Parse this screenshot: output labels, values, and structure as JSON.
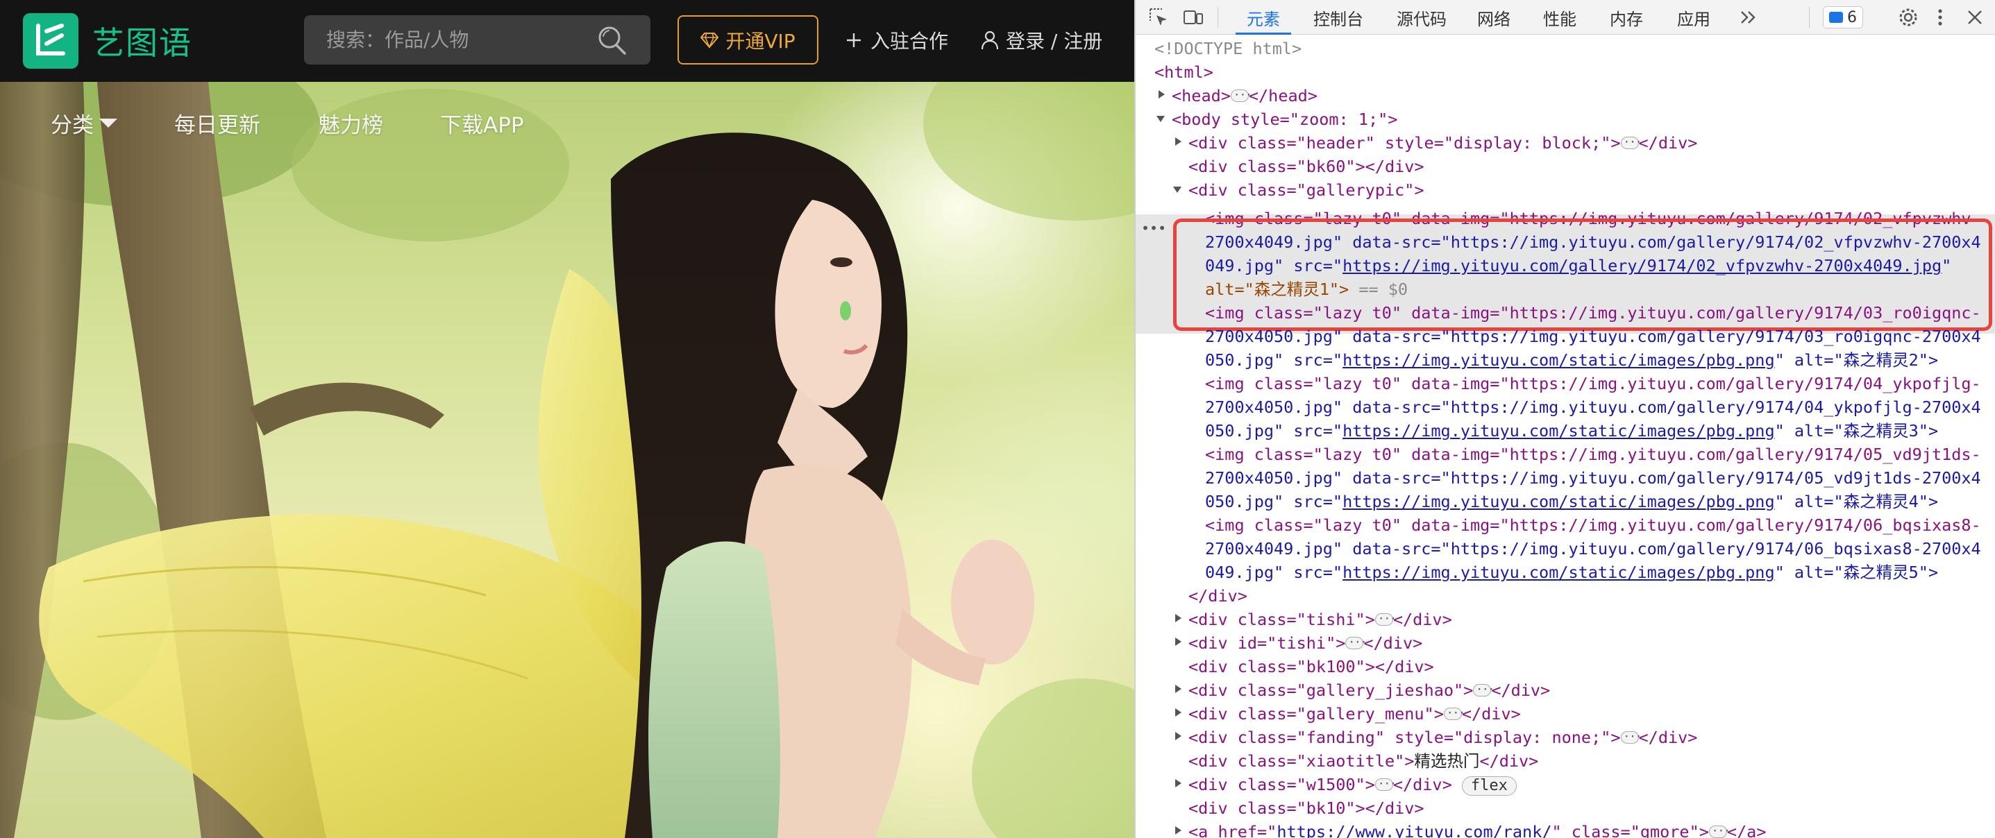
{
  "site": {
    "logo_text": "艺图语",
    "search": {
      "placeholder": "搜索：作品/人物",
      "value": ""
    },
    "vip_label": "开通VIP",
    "join_label": "入驻合作",
    "login_label": "登录 / 注册",
    "subnav": [
      "分类",
      "每日更新",
      "魅力榜",
      "下载APP"
    ],
    "colors": {
      "brand": "#14b383",
      "vip": "#e49f2d",
      "topbar": "#141414"
    },
    "hero_image_alt": "森之精灵1"
  },
  "devtools": {
    "tabs": [
      "元素",
      "控制台",
      "源代码",
      "网络",
      "性能",
      "内存",
      "应用"
    ],
    "active_tab": "元素",
    "more_tabs_icon": "chevron-double-right-icon",
    "issue_count": "6",
    "tree": {
      "doctype": "<!DOCTYPE html>",
      "html_open": "<html>",
      "head": "<head>",
      "head_close": "</head>",
      "body_open": "<body style=\"zoom: 1;\">",
      "header_div": "<div class=\"header\" style=\"display: block;\">",
      "bk60": "<div class=\"bk60\"></div>",
      "gallerypic": "<div class=\"gallerypic\">",
      "img1": {
        "l1": "<img class=\"lazy t0\" data-img=\"https://img.yituyu.com/gallery/9174/02_vfpvzwhv-",
        "l2": "2700x4049.jpg\" data-src=\"https://img.yituyu.com/gallery/9174/02_vfpvzwhv-2700x4",
        "l3_pre": "049.jpg\" src=\"",
        "l3_link": "https://img.yituyu.com/gallery/9174/02_vfpvzwhv-2700x4049.jpg",
        "l3_post": "\"",
        "l4": "alt=\"森之精灵1\">",
        "eq": " == $0"
      },
      "img2": {
        "l1": "<img class=\"lazy t0\" data-img=\"https://img.yituyu.com/gallery/9174/03_ro0igqnc-",
        "l2": "2700x4050.jpg\" data-src=\"https://img.yituyu.com/gallery/9174/03_ro0igqnc-2700x4",
        "l3_pre": "050.jpg\" src=\"",
        "l3_link": "https://img.yituyu.com/static/images/pbg.png",
        "l3_post": "\" alt=\"森之精灵2\">"
      },
      "img3": {
        "l1": "<img class=\"lazy t0\" data-img=\"https://img.yituyu.com/gallery/9174/04_ykpofjlg-",
        "l2": "2700x4050.jpg\" data-src=\"https://img.yituyu.com/gallery/9174/04_ykpofjlg-2700x4",
        "l3_pre": "050.jpg\" src=\"",
        "l3_link": "https://img.yituyu.com/static/images/pbg.png",
        "l3_post": "\" alt=\"森之精灵3\">"
      },
      "img4": {
        "l1": "<img class=\"lazy t0\" data-img=\"https://img.yituyu.com/gallery/9174/05_vd9jt1ds-",
        "l2": "2700x4050.jpg\" data-src=\"https://img.yituyu.com/gallery/9174/05_vd9jt1ds-2700x4",
        "l3_pre": "050.jpg\" src=\"",
        "l3_link": "https://img.yituyu.com/static/images/pbg.png",
        "l3_post": "\" alt=\"森之精灵4\">"
      },
      "img5": {
        "l1": "<img class=\"lazy t0\" data-img=\"https://img.yituyu.com/gallery/9174/06_bqsixas8-",
        "l2": "2700x4049.jpg\" data-src=\"https://img.yituyu.com/gallery/9174/06_bqsixas8-2700x4",
        "l3_pre": "049.jpg\" src=\"",
        "l3_link": "https://img.yituyu.com/static/images/pbg.png",
        "l3_post": "\" alt=\"森之精灵5\">"
      },
      "div_close": "</div>",
      "tishi_class": "<div class=\"tishi\">",
      "tishi_id": "<div id=\"tishi\">",
      "bk100": "<div class=\"bk100\"></div>",
      "jieshao": "<div class=\"gallery_jieshao\">",
      "menu": "<div class=\"gallery_menu\">",
      "fanding": "<div class=\"fanding\" style=\"display: none;\">",
      "xiaotitle_open": "<div class=\"xiaotitle\">",
      "xiaotitle_text": "精选热门",
      "w1500": "<div class=\"w1500\">",
      "flex_badge": "flex",
      "bk10": "<div class=\"bk10\"></div>",
      "a_open": "<a href=\"",
      "a_link": "https://www.yituyu.com/rank/",
      "a_post": "\" class=\"gmore\">",
      "a_close": "</a>"
    }
  }
}
